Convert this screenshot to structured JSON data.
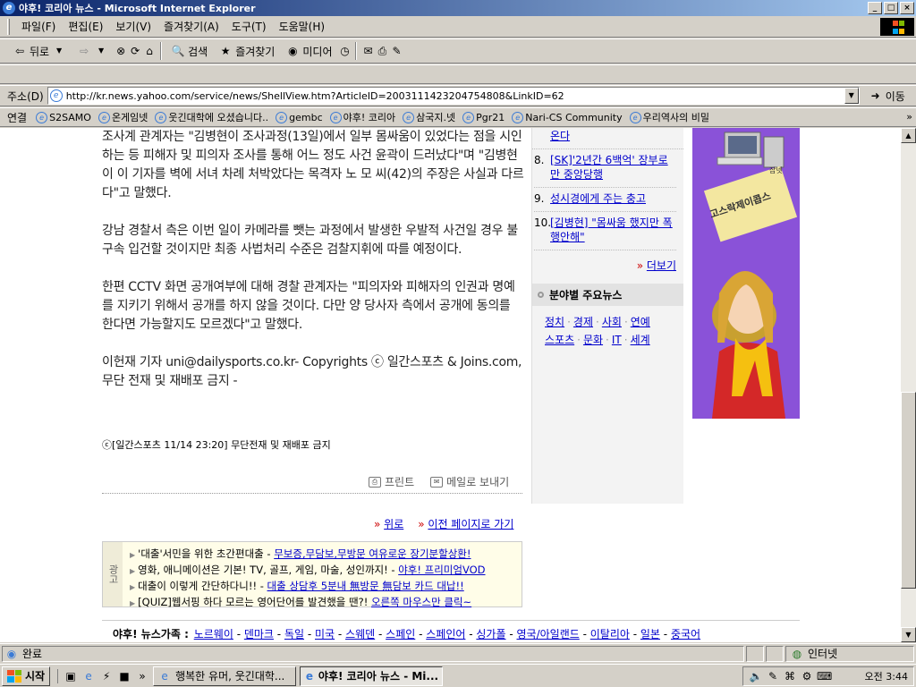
{
  "window": {
    "title": "야후! 코리아 뉴스 - Microsoft Internet Explorer",
    "buttons": {
      "minimize": "_",
      "maximize": "□",
      "close": "×"
    }
  },
  "menu": [
    "파일(F)",
    "편집(E)",
    "보기(V)",
    "즐겨찾기(A)",
    "도구(T)",
    "도움말(H)"
  ],
  "toolbar": {
    "back": "뒤로",
    "search": "검색",
    "favorites": "즐겨찾기",
    "media": "미디어"
  },
  "address": {
    "label": "주소(D)",
    "url": "http://kr.news.yahoo.com/service/news/ShellView.htm?ArticleID=2003111423204754808&LinkID=62",
    "go": "이동"
  },
  "links": {
    "label": "연결",
    "items": [
      "S2SAMO",
      "온게임넷",
      "웃긴대학에 오셨습니다..",
      "gembc",
      "야후! 코리아",
      "삼국지.넷",
      "Pgr21",
      "Nari-CS Community",
      "우리역사의 비밀"
    ]
  },
  "article": {
    "paragraphs": [
      "조사계 관계자는 \"김병현이 조사과정(13일)에서 일부 몸싸움이 있었다는 점을 시인하는 등 피해자 및 피의자 조사를 통해 어느 정도 사건 윤곽이 드러났다\"며 \"김병현이 이 기자를 벽에 서녀 차례 처박았다는 목격자 노 모 씨(42)의 주장은 사실과 다르다\"고 말했다.",
      "강남 경찰서 측은 이번 일이 카메라를 뺏는 과정에서 발생한 우발적 사건일 경우 불구속 입건할 것이지만 최종 사법처리 수준은 검찰지휘에 따를 예정이다.",
      "한편 CCTV 화면 공개여부에 대해 경찰 관계자는 \"피의자와 피해자의 인권과 명예를 지키기 위해서 공개를 하지 않을 것이다. 다만 양 당사자 측에서 공개에 동의를 한다면 가능할지도 모르겠다\"고 말했다.",
      "이헌재 기자 uni@dailysports.co.kr- Copyrights ⓒ 일간스포츠 & Joins.com, 무단 전재 및 재배포 금지 -"
    ],
    "credit": "ⓒ[일간스포츠 11/14 23:20] 무단전재 및 재배포 금지",
    "print": "프린트",
    "email": "메일로 보내기",
    "top": "위로",
    "prev": "이전 페이지로 가기"
  },
  "sidebar": {
    "top_fragment": "온다",
    "items": [
      {
        "num": "8.",
        "text": "[SK]'2년간 6백억' 장부로만 중앙당행"
      },
      {
        "num": "9.",
        "text": "성시경에게 주는 충고"
      },
      {
        "num": "10.",
        "text": "[김병현] \"몸싸움 했지만 폭행안해\""
      }
    ],
    "more": "더보기",
    "category_title": "분야별 주요뉴스",
    "categories": [
      "정치",
      "경제",
      "사회",
      "연예",
      "스포츠",
      "문화",
      "IT",
      "세계"
    ]
  },
  "banner": {
    "text": "고스락제이콥스",
    "badge": "잡넷"
  },
  "ads": {
    "tag": "광고",
    "rows": [
      {
        "text": "'대출'서민을 위한 초간편대출 - ",
        "link": "무보증,무담보,무방문 여유로운 장기분할상환!"
      },
      {
        "text": "영화, 애니메이션은 기본! TV, 골프, 게임, 마술, 성인까지! - ",
        "link": "야후! 프리미엄VOD"
      },
      {
        "text": "대출이 이렇게 간단하다니!! - ",
        "link": "대출 상담후 5분내 無방문 無담보 카드 대납!!"
      },
      {
        "text": "[QUIZ]웹서핑 하다 모르는 영어단어를 발견했을 땐?! ",
        "link": "오른쪽 마우스만 클릭~"
      }
    ]
  },
  "family": {
    "label": "야후! 뉴스가족 :",
    "links": [
      "노르웨이",
      "덴마크",
      "독일",
      "미국",
      "스웨덴",
      "스페인",
      "스페인어",
      "싱가폴",
      "영국/아일랜드",
      "이탈리아",
      "일본",
      "중국어"
    ]
  },
  "status": {
    "text": "완료",
    "zone": "인터넷"
  },
  "taskbar": {
    "start": "시작",
    "tasks": [
      "행복한 유머, 웃긴대학...",
      "야후! 코리아 뉴스 - Mi..."
    ],
    "clock": "오전 3:44"
  },
  "colors": {
    "link": "#0000cc",
    "titlebar": "#0a246a",
    "banner": "#8a52d8"
  }
}
